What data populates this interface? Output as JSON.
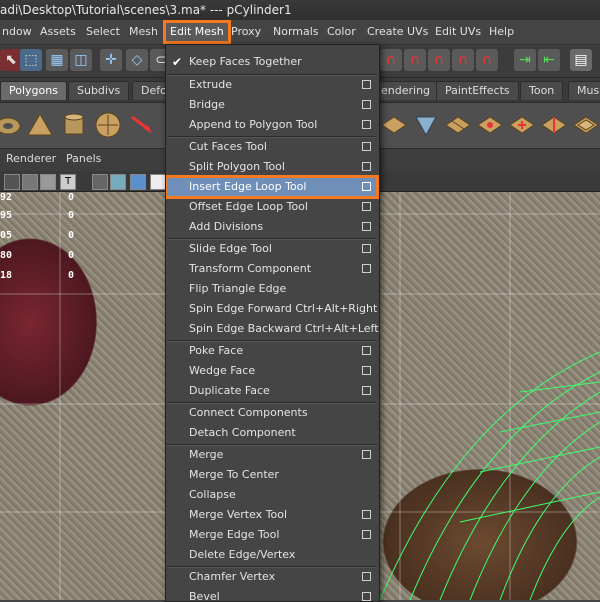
{
  "window": {
    "title": "adi\\Desktop\\Tutorial\\scenes\\3.ma*   ---   pCylinder1"
  },
  "menubar": {
    "items": [
      "ndow",
      "Assets",
      "Select",
      "Mesh",
      "Edit Mesh",
      "Proxy",
      "Normals",
      "Color",
      "Create UVs",
      "Edit UVs",
      "Help"
    ],
    "active": "Edit Mesh"
  },
  "shelf_tabs": {
    "items": [
      "Polygons",
      "Subdivs",
      "Defo",
      "endering",
      "PaintEffects",
      "Toon",
      "Musc"
    ],
    "active": "Polygons"
  },
  "viewport_menu": {
    "items": [
      "Renderer",
      "Panels"
    ]
  },
  "hud": {
    "rows": [
      {
        "left": "92",
        "right": "0"
      },
      {
        "left": "95",
        "right": "0"
      },
      {
        "left": "05",
        "right": "0"
      },
      {
        "left": "80",
        "right": "0"
      },
      {
        "left": "18",
        "right": "0"
      }
    ]
  },
  "edit_mesh_menu": {
    "items": [
      {
        "label": "Keep Faces Together",
        "checked": true,
        "option_box": false
      },
      {
        "label": "Extrude",
        "option_box": true
      },
      {
        "label": "Bridge",
        "option_box": true
      },
      {
        "label": "Append to Polygon Tool",
        "option_box": true
      },
      {
        "label": "Cut Faces Tool",
        "option_box": true
      },
      {
        "label": "Split Polygon Tool",
        "option_box": true
      },
      {
        "label": "Insert Edge Loop Tool",
        "option_box": true,
        "highlighted": true
      },
      {
        "label": "Offset Edge Loop Tool",
        "option_box": true
      },
      {
        "label": "Add Divisions",
        "option_box": true
      },
      {
        "label": "Slide Edge Tool",
        "option_box": true
      },
      {
        "label": "Transform Component",
        "option_box": true
      },
      {
        "label": "Flip Triangle Edge",
        "option_box": false
      },
      {
        "label": "Spin Edge Forward  Ctrl+Alt+Right",
        "option_box": false
      },
      {
        "label": "Spin Edge Backward  Ctrl+Alt+Left",
        "option_box": false
      },
      {
        "label": "Poke Face",
        "option_box": true
      },
      {
        "label": "Wedge Face",
        "option_box": true
      },
      {
        "label": "Duplicate Face",
        "option_box": true
      },
      {
        "label": "Connect Components",
        "option_box": false
      },
      {
        "label": "Detach Component",
        "option_box": false
      },
      {
        "label": "Merge",
        "option_box": true
      },
      {
        "label": "Merge To Center",
        "option_box": false
      },
      {
        "label": "Collapse",
        "option_box": false
      },
      {
        "label": "Merge Vertex Tool",
        "option_box": true
      },
      {
        "label": "Merge Edge Tool",
        "option_box": true
      },
      {
        "label": "Delete Edge/Vertex",
        "option_box": false
      },
      {
        "label": "Chamfer Vertex",
        "option_box": true
      },
      {
        "label": "Bevel",
        "option_box": true
      }
    ]
  },
  "colors": {
    "highlight": "#6f8fb8",
    "callout": "#f47920"
  }
}
